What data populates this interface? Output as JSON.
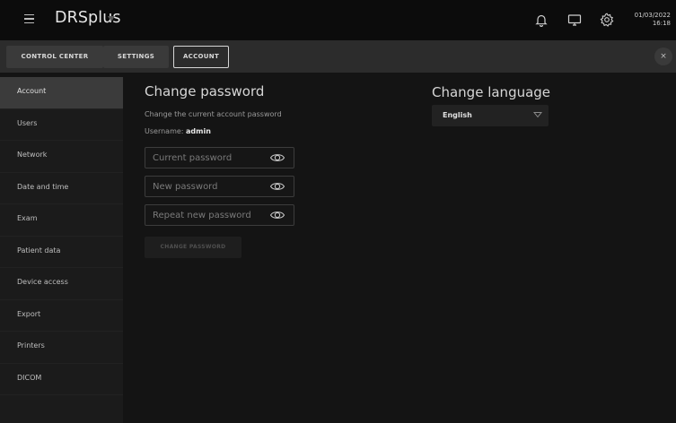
{
  "app": {
    "title": "DRSplus"
  },
  "topbar": {
    "date": "01/03/2022",
    "time": "16:18",
    "icons": [
      "bell-icon",
      "monitor-icon",
      "gear-icon"
    ]
  },
  "tabs": [
    {
      "label": "CONTROL CENTER",
      "active": false
    },
    {
      "label": "SETTINGS",
      "active": false
    },
    {
      "label": "ACCOUNT",
      "active": true
    }
  ],
  "close_label": "×",
  "sidebar": {
    "items": [
      {
        "label": "Account",
        "active": true
      },
      {
        "label": "Users"
      },
      {
        "label": "Network"
      },
      {
        "label": "Date and time"
      },
      {
        "label": "Exam"
      },
      {
        "label": "Patient data"
      },
      {
        "label": "Device access"
      },
      {
        "label": "Export"
      },
      {
        "label": "Printers"
      },
      {
        "label": "DICOM"
      }
    ]
  },
  "password": {
    "heading": "Change password",
    "description": "Change the current account password",
    "username_label": "Username:",
    "username_value": "admin",
    "current_placeholder": "Current password",
    "new_placeholder": "New password",
    "repeat_placeholder": "Repeat new password",
    "button_label": "CHANGE PASSWORD"
  },
  "language": {
    "heading": "Change language",
    "selected": "English"
  },
  "colors": {
    "background": "#141414",
    "topbar": "#0c0c0c",
    "tabbar": "#2c2c2c",
    "sidebar": "#1b1b1b",
    "sidebar_active": "#3b3b3b"
  }
}
